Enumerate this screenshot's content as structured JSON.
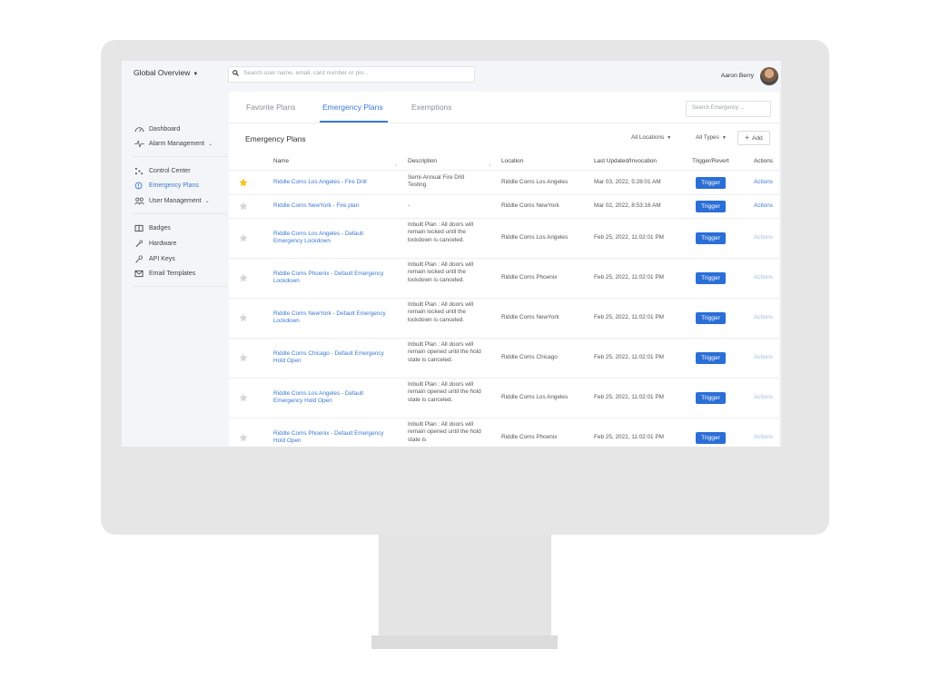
{
  "topbar": {
    "global_label": "Global Overview",
    "search_placeholder": "Search user name, email, card number or pin...",
    "user_name": "Aaron Berry"
  },
  "sidebar": {
    "items": [
      {
        "label": "Dashboard",
        "icon": "gauge-icon"
      },
      {
        "label": "Alarm Management",
        "icon": "pulse-icon"
      },
      {
        "label": "Control Center",
        "icon": "control-center-icon"
      },
      {
        "label": "Emergency Plans",
        "icon": "alert-circle-icon"
      },
      {
        "label": "User Management",
        "icon": "users-icon"
      },
      {
        "label": "Badges",
        "icon": "badge-icon"
      },
      {
        "label": "Hardware",
        "icon": "wrench-icon"
      },
      {
        "label": "API Keys",
        "icon": "key-icon"
      },
      {
        "label": "Email Templates",
        "icon": "mail-icon"
      }
    ]
  },
  "tabs": [
    "Favorite Plans",
    "Emergency Plans",
    "Exemptions"
  ],
  "search_emergency_placeholder": "Search Emergency ...",
  "section": {
    "title": "Emergency Plans",
    "filter_locations": "All Locations",
    "filter_types": "All Types",
    "add_label": "Add"
  },
  "table": {
    "headers": [
      "Name",
      "Description",
      "Location",
      "Last Updated/Invocation",
      "Trigger/Revert",
      "Actions"
    ],
    "trigger_label": "Trigger",
    "actions_label": "Actions",
    "rows": [
      {
        "favorite": true,
        "name": "Riddle Coms Los Angeles - Fire Drill",
        "description": "Semi-Annual Fire Drill Testing",
        "location": "Riddle Coms Los Angeles",
        "updated": "Mar 03, 2022, 5:28:01 AM"
      },
      {
        "favorite": false,
        "name": "Riddle Coms NewYork - Fire plan",
        "description": "-",
        "location": "Riddle Coms NewYork",
        "updated": "Mar 02, 2022, 8:53:16 AM"
      },
      {
        "favorite": false,
        "name": "Riddle Coms Los Angeles - Default Emergency Lockdown",
        "description": "Inbuilt Plan : All doors will remain locked until the lockdown is canceled.",
        "location": "Riddle Coms Los Angeles",
        "updated": "Feb 25, 2022, 11:02:01 PM"
      },
      {
        "favorite": false,
        "name": "Riddle Coms Phoenix - Default Emergency Lockdown",
        "description": "Inbuilt Plan : All doors will remain locked until the lockdown is canceled.",
        "location": "Riddle Coms Phoenix",
        "updated": "Feb 25, 2022, 11:02:01 PM"
      },
      {
        "favorite": false,
        "name": "Riddle Coms NewYork - Default Emergency Lockdown",
        "description": "Inbuilt Plan : All doors will remain locked until the lockdown is canceled.",
        "location": "Riddle Coms NewYork",
        "updated": "Feb 25, 2022, 11:02:01 PM"
      },
      {
        "favorite": false,
        "name": "Riddle Coms Chicago - Default Emergency Hold Open",
        "description": "Inbuilt Plan : All doors will remain opened until the hold state is canceled.",
        "location": "Riddle Coms Chicago",
        "updated": "Feb 25, 2022, 11:02:01 PM"
      },
      {
        "favorite": false,
        "name": "Riddle Coms Los Angeles - Default Emergency Hold Open",
        "description": "Inbuilt Plan : All doors will remain opened until the hold state is canceled.",
        "location": "Riddle Coms Los Angeles",
        "updated": "Feb 25, 2022, 11:02:01 PM"
      },
      {
        "favorite": false,
        "name": "Riddle Coms Phoenix - Default Emergency Hold Open",
        "description": "Inbuilt Plan : All doors will remain opened until the hold state is",
        "location": "Riddle Coms Phoenix",
        "updated": "Feb 25, 2022, 11:02:01 PM"
      }
    ]
  },
  "colors": {
    "accent": "#3a78d6",
    "trigger": "#2b6fd6",
    "star_active": "#f4c20d",
    "star_inactive": "#d3d5d9"
  }
}
